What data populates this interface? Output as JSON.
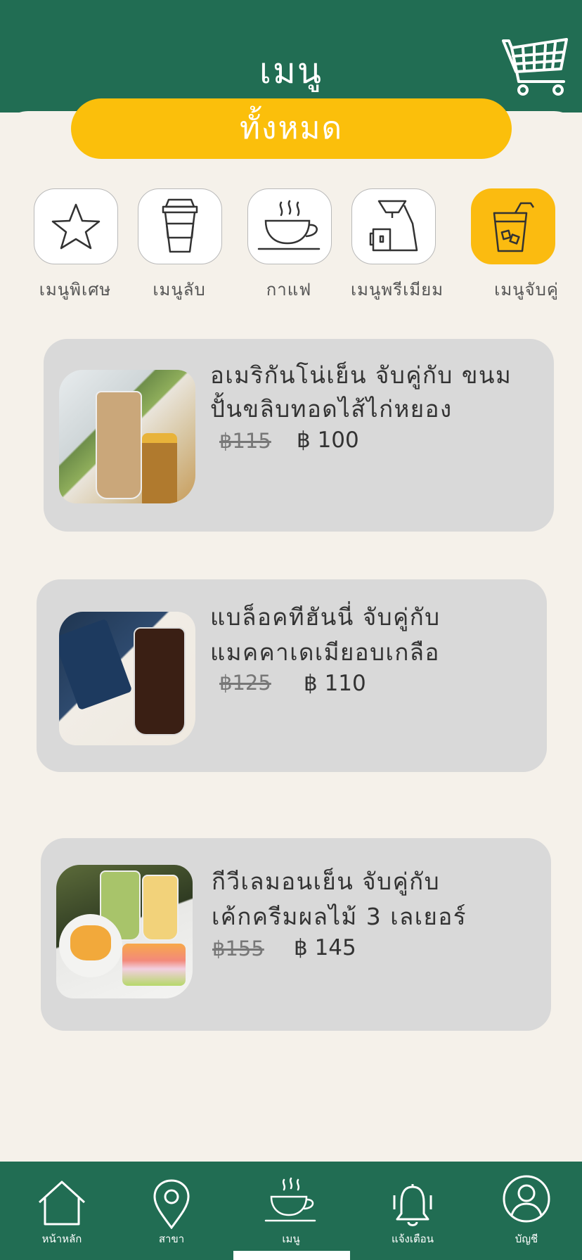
{
  "header": {
    "title": "เมนู"
  },
  "filter": {
    "all_label": "ทั้งหมด"
  },
  "categories": [
    {
      "label": "เมนูพิเศษ",
      "icon": "star-icon"
    },
    {
      "label": "เมนูลับ",
      "icon": "takeaway-cup-icon"
    },
    {
      "label": "กาแฟ",
      "icon": "coffee-cup-icon"
    },
    {
      "label": "เมนูพรีเมียม",
      "icon": "drip-coffee-icon"
    },
    {
      "label": "เมนูจับคู่",
      "icon": "iced-drink-icon",
      "active": true
    }
  ],
  "items": [
    {
      "title_line1": "อเมริกันโน่เย็น จับคู่กับ ขนม",
      "title_line2": "ปั้นขลิบทอดไส้ไก่หยอง",
      "old_price": "฿115",
      "price": "฿ 100"
    },
    {
      "title_line1": "แบล็อคทีฮันนี่ จับคู่กับ",
      "title_line2": "แมคคาเดเมียอบเกลือ",
      "old_price": "฿125",
      "price": "฿ 110"
    },
    {
      "title_line1": "กีวีเลมอนเย็น จับคู่กับ",
      "title_line2": "เค้กครีมผลไม้ 3 เลเยอร์",
      "old_price": "฿155",
      "price": "฿ 145"
    }
  ],
  "nav": [
    {
      "label": "หน้าหลัก",
      "icon": "home-icon"
    },
    {
      "label": "สาขา",
      "icon": "location-pin-icon"
    },
    {
      "label": "เมนู",
      "icon": "coffee-cup-icon"
    },
    {
      "label": "แจ้งเตือน",
      "icon": "bell-icon"
    },
    {
      "label": "บัญชี",
      "icon": "user-icon"
    }
  ],
  "colors": {
    "primary_green": "#216d53",
    "accent_yellow": "#fbbf0b",
    "background": "#f5f1ea",
    "card": "#d9d9d9"
  }
}
